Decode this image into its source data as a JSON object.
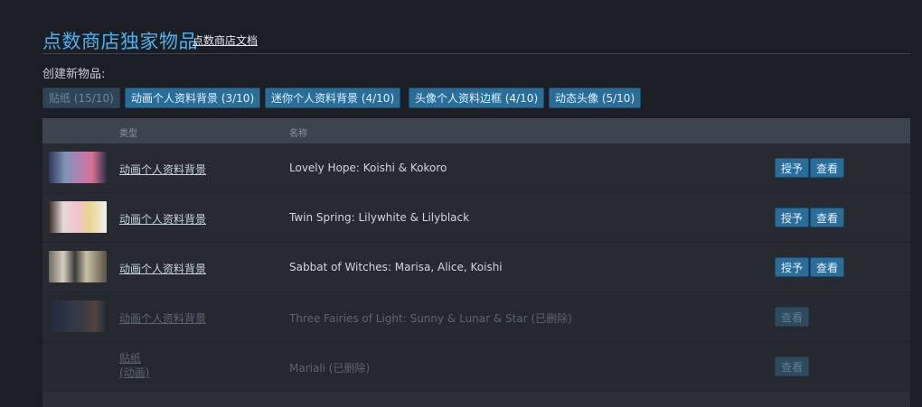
{
  "header": {
    "title": "点数商店独家物品",
    "doc_link": "点数商店文档"
  },
  "create": {
    "label": "创建新物品:",
    "buttons": [
      {
        "label": "贴纸 (15/10)",
        "enabled": false
      },
      {
        "label": "动画个人资料背景 (3/10)",
        "enabled": true
      },
      {
        "label": "迷你个人资料背景 (4/10)",
        "enabled": true
      },
      {
        "label": "头像个人资料边框 (4/10)",
        "enabled": true
      },
      {
        "label": "动态头像 (5/10)",
        "enabled": true
      }
    ]
  },
  "table": {
    "columns": {
      "type": "类型",
      "name": "名称"
    },
    "rows": [
      {
        "type": "动画个人资料背景",
        "name": "Lovely Hope: Koishi & Kokoro",
        "grant": "授予",
        "view": "查看"
      },
      {
        "type": "动画个人资料背景",
        "name": "Twin Spring: Lilywhite & Lilyblack",
        "grant": "授予",
        "view": "查看"
      },
      {
        "type": "动画个人资料背景",
        "name": "Sabbat of Witches: Marisa, Alice, Koishi",
        "grant": "授予",
        "view": "查看"
      },
      {
        "type": "动画个人资料背景",
        "name": "Three Fairies of Light: Sunny & Lunar & Star (已删除)",
        "view": "查看"
      },
      {
        "type_line1": "贴纸",
        "type_line2": "(动画)",
        "name": "Mariali (已删除)",
        "view": "查看"
      }
    ]
  },
  "colors": {
    "accent": "#4fb0ef",
    "button": "#2a6d99",
    "background": "#1b1e24"
  }
}
